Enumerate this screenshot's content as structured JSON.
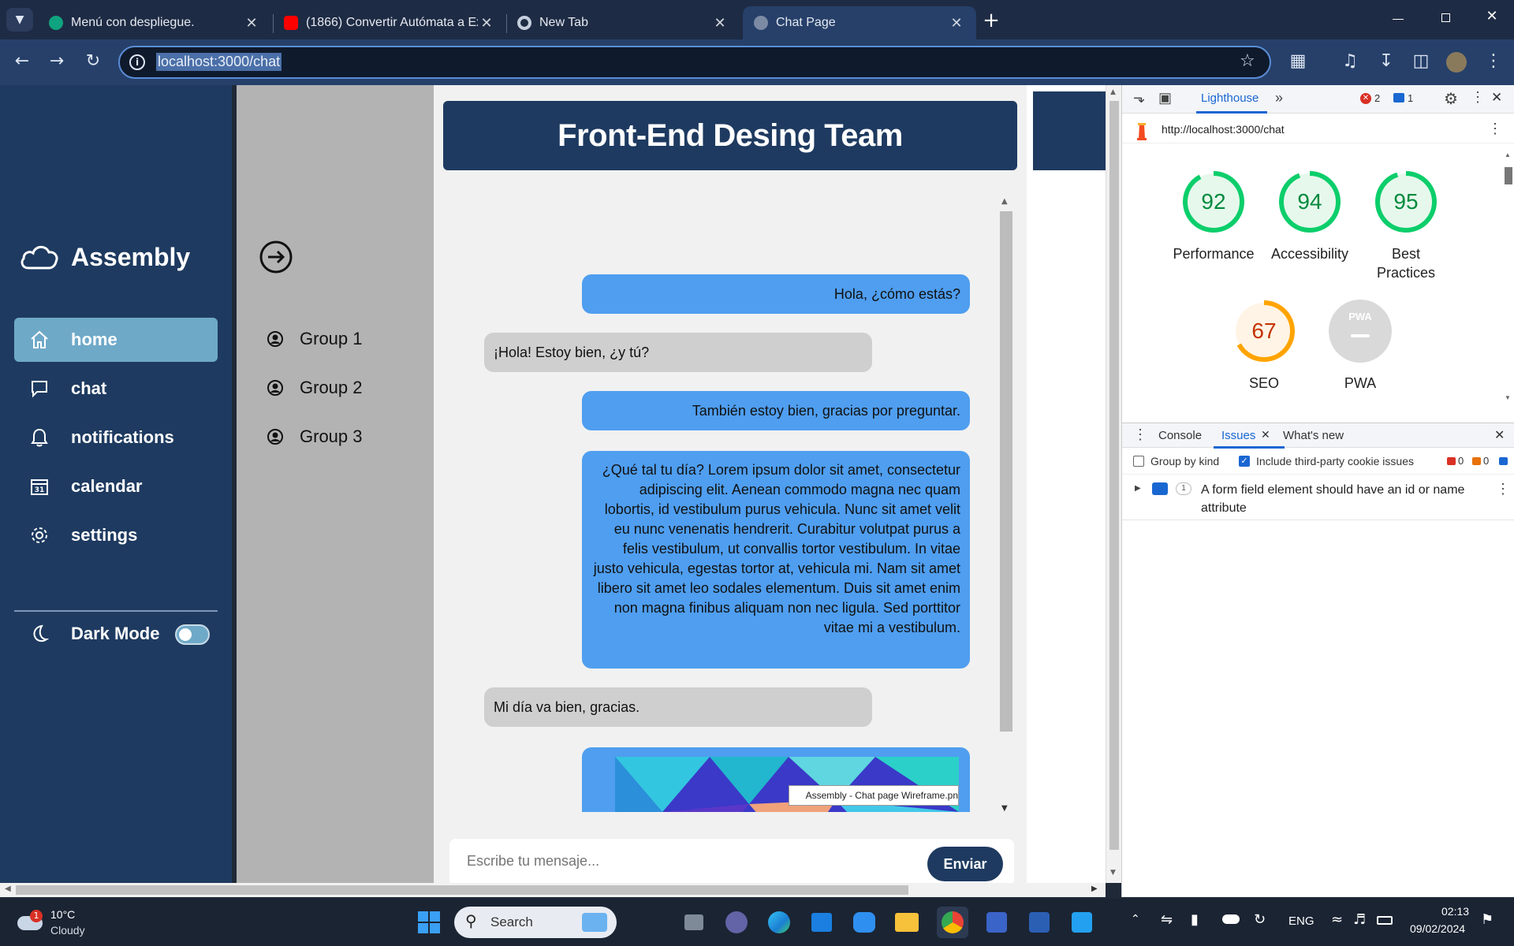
{
  "browser": {
    "tabs": [
      {
        "title": "Menú con despliegue.",
        "active": false
      },
      {
        "title": "(1866) Convertir Autómata a Ex",
        "active": false
      },
      {
        "title": "New Tab",
        "active": false
      },
      {
        "title": "Chat Page",
        "active": true
      }
    ],
    "url": "localhost:3000/chat"
  },
  "sidebar": {
    "brand": "Assembly",
    "items": [
      {
        "label": "home",
        "icon": "home-icon",
        "active": true
      },
      {
        "label": "chat",
        "icon": "chat-icon",
        "active": false
      },
      {
        "label": "notifications",
        "icon": "bell-icon",
        "active": false
      },
      {
        "label": "calendar",
        "icon": "calendar-icon",
        "active": false
      },
      {
        "label": "settings",
        "icon": "gear-icon",
        "active": false
      }
    ],
    "dark_mode_label": "Dark Mode",
    "dark_mode_on": false
  },
  "groups": [
    {
      "label": "Group 1"
    },
    {
      "label": "Group 2"
    },
    {
      "label": "Group 3"
    }
  ],
  "chat": {
    "title": "Front-End Desing Team",
    "messages": [
      {
        "direction": "out",
        "text": "Hola, ¿cómo estás?"
      },
      {
        "direction": "in",
        "text": "¡Hola! Estoy bien, ¿y tú?"
      },
      {
        "direction": "out",
        "text": "También estoy bien, gracias por preguntar."
      },
      {
        "direction": "out",
        "text": "¿Qué tal tu día? Lorem ipsum dolor sit amet, consectetur adipiscing elit. Aenean commodo magna nec quam lobortis, id vestibulum purus vehicula. Nunc sit amet velit eu nunc venenatis hendrerit. Curabitur volutpat purus a felis vestibulum, ut convallis tortor vestibulum. In vitae justo vehicula, egestas tortor at, vehicula mi. Nam sit amet libero sit amet leo sodales elementum. Duis sit amet enim non magna finibus aliquam non nec ligula. Sed porttitor vitae mi a vestibulum."
      },
      {
        "direction": "in",
        "text": "Mi día va bien, gracias."
      },
      {
        "direction": "out",
        "type": "image",
        "tooltip": "Assembly - Chat page Wireframe.pn"
      }
    ],
    "input_placeholder": "Escribe tu mensaje...",
    "send_label": "Enviar"
  },
  "devtools": {
    "top_tab": "Lighthouse",
    "error_count": "2",
    "message_count": "1",
    "report_url": "http://localhost:3000/chat",
    "scores": [
      {
        "label": "Performance",
        "value": 92,
        "color": "#0cce6b",
        "text_color": "#008a3e"
      },
      {
        "label": "Accessibility",
        "value": 94,
        "color": "#0cce6b",
        "text_color": "#008a3e"
      },
      {
        "label": "Best Practices",
        "value": 95,
        "color": "#0cce6b",
        "text_color": "#008a3e"
      },
      {
        "label": "SEO",
        "value": 67,
        "color": "#ffa400",
        "text_color": "#c33300"
      },
      {
        "label": "PWA",
        "value": null,
        "color": "#cccccc",
        "text_color": "#999999"
      }
    ],
    "pwa_badge": "PWA",
    "drawer_tabs": [
      {
        "label": "Console",
        "active": false
      },
      {
        "label": "Issues",
        "active": true
      },
      {
        "label": "What's new",
        "active": false
      }
    ],
    "group_by_kind_label": "Group by kind",
    "group_by_kind_checked": false,
    "third_party_label": "Include third-party cookie issues",
    "third_party_checked": true,
    "issue_counts": [
      "0",
      "0"
    ],
    "issue": {
      "count": "1",
      "text": "A form field element should have an id or name attribute"
    }
  },
  "taskbar": {
    "weather_temp": "10°C",
    "weather_desc": "Cloudy",
    "weather_badge": "1",
    "search_label": "Search",
    "language": "ENG",
    "time": "02:13",
    "date": "09/02/2024"
  }
}
